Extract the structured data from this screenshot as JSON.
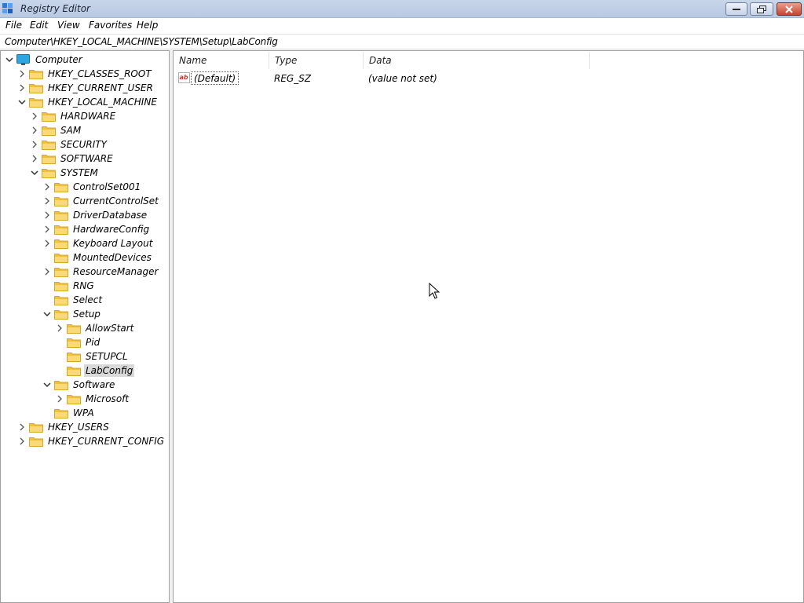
{
  "window": {
    "title": "Registry Editor"
  },
  "menu": [
    "File",
    "Edit",
    "View",
    "Favorites",
    "Help"
  ],
  "address": "Computer\\HKEY_LOCAL_MACHINE\\SYSTEM\\Setup\\LabConfig",
  "tree": {
    "root": "Computer",
    "nodes": [
      {
        "label": "HKEY_CLASSES_ROOT"
      },
      {
        "label": "HKEY_CURRENT_USER"
      },
      {
        "label": "HKEY_LOCAL_MACHINE"
      },
      {
        "label": "HARDWARE"
      },
      {
        "label": "SAM"
      },
      {
        "label": "SECURITY"
      },
      {
        "label": "SOFTWARE"
      },
      {
        "label": "SYSTEM"
      },
      {
        "label": "ControlSet001"
      },
      {
        "label": "CurrentControlSet"
      },
      {
        "label": "DriverDatabase"
      },
      {
        "label": "HardwareConfig"
      },
      {
        "label": "Keyboard Layout"
      },
      {
        "label": "MountedDevices"
      },
      {
        "label": "ResourceManager"
      },
      {
        "label": "RNG"
      },
      {
        "label": "Select"
      },
      {
        "label": "Setup"
      },
      {
        "label": "AllowStart"
      },
      {
        "label": "Pid"
      },
      {
        "label": "SETUPCL"
      },
      {
        "label": "LabConfig"
      },
      {
        "label": "Software"
      },
      {
        "label": "Microsoft"
      },
      {
        "label": "WPA"
      },
      {
        "label": "HKEY_USERS"
      },
      {
        "label": "HKEY_CURRENT_CONFIG"
      }
    ]
  },
  "list": {
    "columns": [
      "Name",
      "Type",
      "Data"
    ],
    "rows": [
      {
        "name": "(Default)",
        "type": "REG_SZ",
        "data": "(value not set)",
        "icon": "string-value-icon"
      }
    ]
  },
  "colors": {
    "folder": "#f6cf57",
    "selection": "#d9d9d9",
    "titlebar": "#bfcde6"
  }
}
